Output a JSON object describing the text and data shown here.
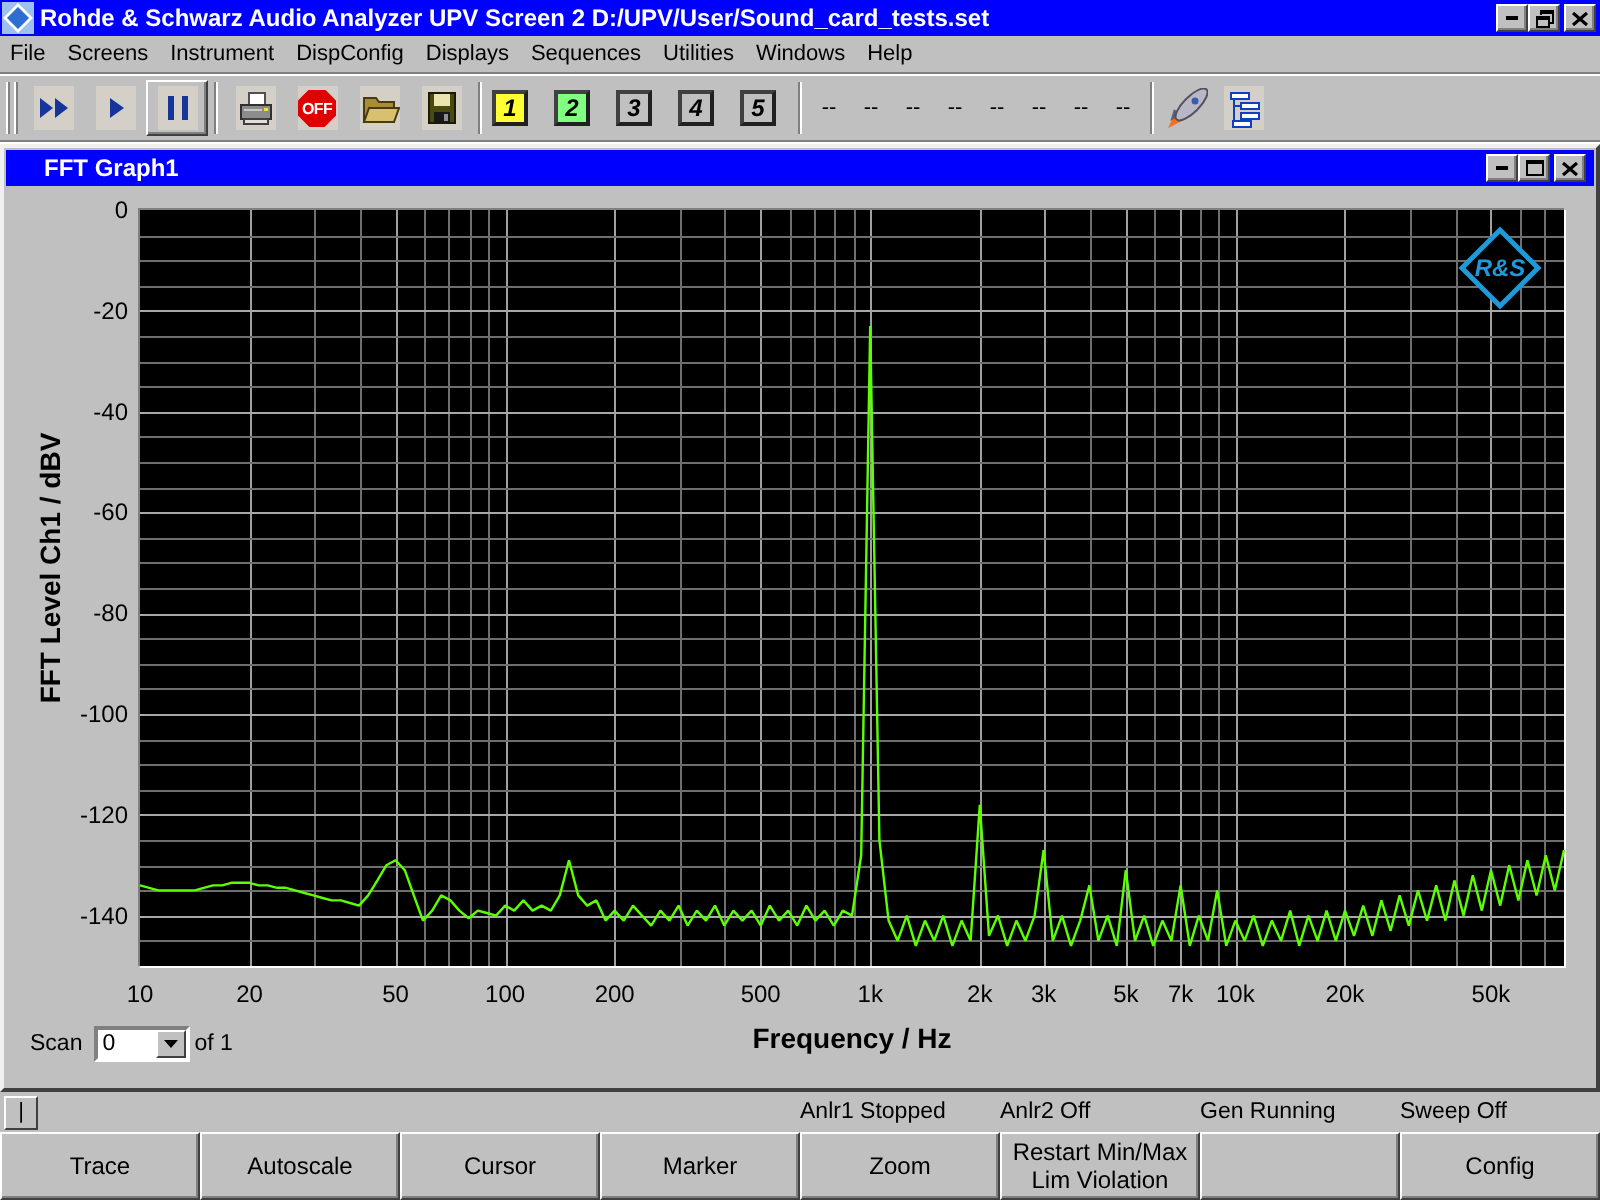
{
  "window": {
    "title": "Rohde & Schwarz Audio Analyzer UPV Screen 2 D:/UPV/User/Sound_card_tests.set"
  },
  "menu": {
    "items": [
      "File",
      "Screens",
      "Instrument",
      "DispConfig",
      "Displays",
      "Sequences",
      "Utilities",
      "Windows",
      "Help"
    ]
  },
  "toolbar": {
    "transport": [
      {
        "kind": "fastforward",
        "selected": false
      },
      {
        "kind": "play",
        "selected": false
      },
      {
        "kind": "pause",
        "selected": true
      }
    ],
    "actions": [
      {
        "kind": "print"
      },
      {
        "kind": "off",
        "label": "OFF"
      },
      {
        "kind": "open"
      },
      {
        "kind": "save"
      }
    ],
    "screens": [
      {
        "label": "1",
        "color": "#ffff33"
      },
      {
        "label": "2",
        "color": "#80ff80"
      },
      {
        "label": "3",
        "color": "#c0c0c0"
      },
      {
        "label": "4",
        "color": "#c0c0c0"
      },
      {
        "label": "5",
        "color": "#c0c0c0"
      }
    ],
    "slots": [
      "--",
      "--",
      "--",
      "--",
      "--",
      "--",
      "--",
      "--"
    ],
    "tools": [
      {
        "kind": "rocket"
      },
      {
        "kind": "tree"
      }
    ]
  },
  "graph_window": {
    "title": "FFT Graph1",
    "logo": "R&S",
    "chart_data": {
      "type": "line",
      "xlabel": "Frequency / Hz",
      "ylabel": "FFT Level Ch1 / dBV",
      "grid": true,
      "categories": [
        "10",
        null,
        null,
        null,
        null,
        null,
        null,
        null,
        null,
        null,
        null,
        null,
        "20",
        null,
        null,
        null,
        null,
        null,
        null,
        null,
        null,
        null,
        null,
        null,
        null,
        null,
        null,
        null,
        "50",
        null,
        null,
        null,
        null,
        null,
        null,
        null,
        null,
        null,
        null,
        null,
        "100",
        null,
        null,
        null,
        null,
        null,
        null,
        null,
        null,
        null,
        null,
        null,
        "200",
        null,
        null,
        null,
        null,
        null,
        null,
        null,
        null,
        null,
        null,
        null,
        null,
        null,
        null,
        null,
        "500",
        null,
        null,
        null,
        null,
        null,
        null,
        null,
        null,
        null,
        null,
        null,
        "1k",
        null,
        null,
        null,
        null,
        null,
        null,
        null,
        null,
        null,
        null,
        null,
        "2k",
        null,
        null,
        null,
        null,
        null,
        null,
        "3k",
        null,
        null,
        null,
        null,
        null,
        null,
        null,
        null,
        "5k",
        null,
        null,
        null,
        null,
        null,
        "7k",
        null,
        null,
        null,
        null,
        null,
        "10k",
        null,
        null,
        null,
        null,
        null,
        null,
        null,
        null,
        null,
        null,
        null,
        "20k",
        null,
        null,
        null,
        null,
        null,
        null,
        null,
        null,
        null,
        null,
        null,
        null,
        null,
        null,
        null,
        "50k",
        null,
        null,
        null,
        null,
        null,
        null,
        null,
        null
      ],
      "values": [
        -134,
        -134.5,
        -135,
        -135,
        -135,
        -135,
        -135,
        -134.5,
        -134,
        -134,
        -133.5,
        -133.5,
        -133.5,
        -134,
        -134,
        -134.5,
        -134.5,
        -135,
        -135.5,
        -136,
        -136.5,
        -137,
        -137,
        -137.5,
        -138,
        -136,
        -133,
        -130,
        -129,
        -131,
        -136,
        -141,
        -139,
        -136,
        -137,
        -139,
        -140.5,
        -139,
        -139.5,
        -140,
        -138,
        -139,
        -137,
        -139,
        -138,
        -139,
        -136,
        -129,
        -136,
        -138,
        -137,
        -141,
        -139,
        -141,
        -138,
        -140,
        -142,
        -139,
        -141,
        -138,
        -142,
        -139,
        -141,
        -138,
        -142,
        -139,
        -141,
        -139,
        -142,
        -138,
        -141,
        -139,
        -142,
        -138,
        -141,
        -139,
        -142,
        -139,
        -140,
        -128,
        -23,
        -125,
        -141,
        -145,
        -140,
        -146,
        -141,
        -145,
        -140,
        -146,
        -141,
        -145,
        -118,
        -144,
        -140,
        -146,
        -141,
        -145,
        -140,
        -127,
        -145,
        -140,
        -146,
        -141,
        -134,
        -145,
        -140,
        -146,
        -131,
        -145,
        -140,
        -146,
        -141,
        -145,
        -134,
        -146,
        -140,
        -145,
        -135,
        -146,
        -141,
        -145,
        -140,
        -146,
        -141,
        -145,
        -139,
        -146,
        -140,
        -145,
        -139,
        -145,
        -139,
        -144,
        -138,
        -144,
        -137,
        -143,
        -136,
        -142,
        -135,
        -141,
        -134,
        -141,
        -133,
        -140,
        -132,
        -139,
        -131,
        -138,
        -130,
        -137,
        -129,
        -136,
        -128,
        -135,
        -127
      ],
      "ylim": [
        -150,
        0
      ],
      "yticks": [
        0,
        -20,
        -40,
        -60,
        -80,
        -100,
        -120,
        -140
      ]
    },
    "scan": {
      "label": "Scan",
      "value": "0",
      "suffix": "of 1"
    }
  },
  "status_bar": {
    "toggle": "|",
    "items": [
      "Anlr1 Stopped",
      "Anlr2 Off",
      "Gen Running",
      "Sweep Off"
    ]
  },
  "softkeys": [
    {
      "kind": "label",
      "label": "Trace"
    },
    {
      "kind": "label",
      "label": "Autoscale"
    },
    {
      "kind": "label",
      "label": "Cursor"
    },
    {
      "kind": "label",
      "label": "Marker"
    },
    {
      "kind": "label",
      "label": "Zoom"
    },
    {
      "kind": "twoline",
      "lines": [
        "Restart Min/Max",
        "Lim Violation"
      ]
    },
    {
      "kind": "blank"
    },
    {
      "kind": "label",
      "label": "Config"
    }
  ]
}
